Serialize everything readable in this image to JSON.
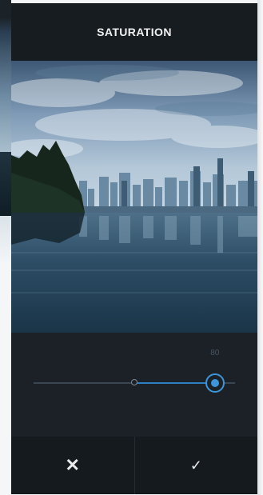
{
  "header": {
    "title": "SATURATION"
  },
  "slider": {
    "value_label": "80",
    "value": 80,
    "min": -100,
    "max": 100
  },
  "actions": {
    "cancel_icon": "✕",
    "confirm_icon": "✓"
  },
  "colors": {
    "accent": "#3f95d9",
    "fill": "#2d7fc1",
    "background": "#181e23",
    "title_text": "#f1f1f1"
  },
  "icons": [
    "close-icon",
    "checkmark-icon"
  ]
}
